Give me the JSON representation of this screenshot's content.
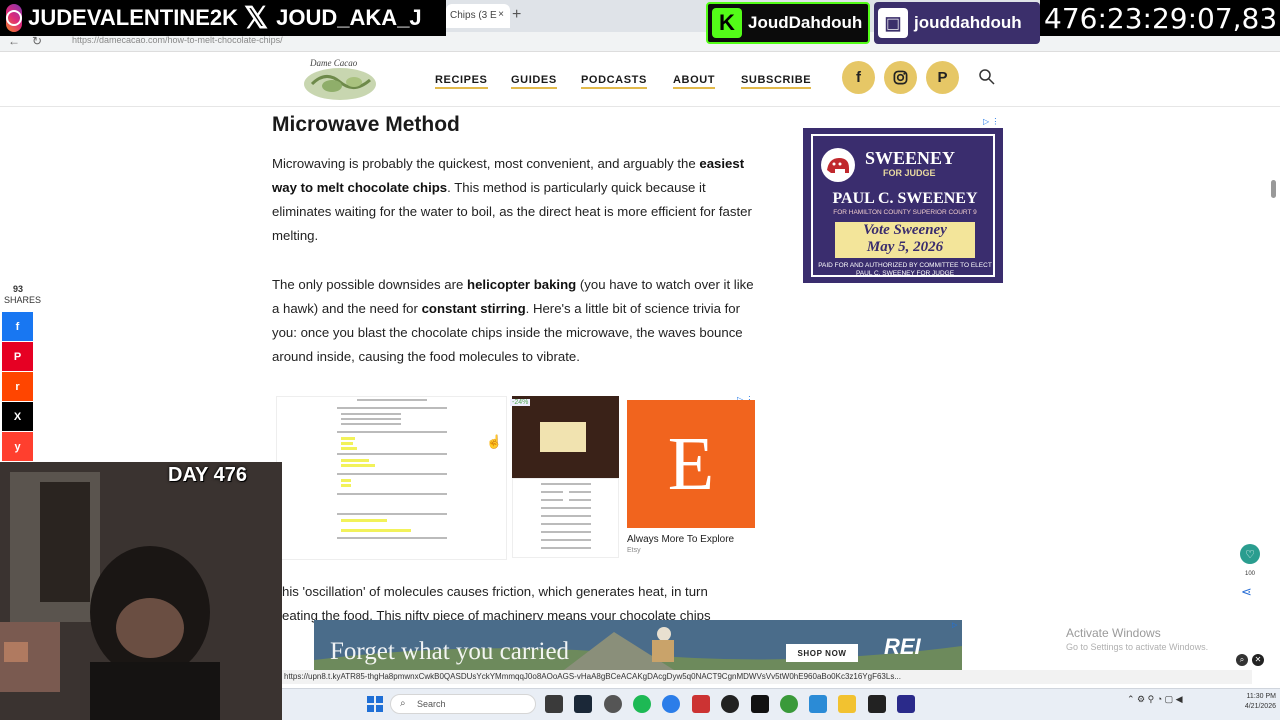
{
  "browser": {
    "tab_title": "Chips (3 E",
    "tab_close": "×",
    "new_tab": "+",
    "url": "https://damecacao.com/how-to-melt-chocolate-chips/",
    "back": "←",
    "reload": "↻"
  },
  "overlay": {
    "instagram": "JUDEVALENTINE2K",
    "x_handle": "JOUD_AKA_J",
    "kick": "JoudDahdouh",
    "twitch": "jouddahdouh",
    "timer": "476:23:29:07,83",
    "day": "DAY 476",
    "colors": {
      "kick": "#53fc18",
      "twitch": "#3b2f6b"
    }
  },
  "site": {
    "nav": [
      "RECIPES",
      "GUIDES",
      "PODCASTS",
      "ABOUT",
      "SUBSCRIBE"
    ],
    "social": [
      "f",
      "ig",
      "P"
    ],
    "accent": "#e6c766"
  },
  "article": {
    "heading": "Microwave Method",
    "p1_a": "Microwaving is probably the quickest, most convenient, and arguably the",
    "p1_bold": "easiest way to melt chocolate chips",
    "p1_b": ". This method is particularly quick because it eliminates waiting for the water to boil, as the direct heat is more efficient for faster melting.",
    "p2_a": "The only possible downsides are",
    "p2_bold1": "helicopter baking",
    "p2_b": "(you have to watch over it like a hawk) and the need for",
    "p2_bold2": "constant stirring",
    "p2_c": ". Here's a little bit of science trivia for you: once you blast the chocolate chips inside the microwave, the waves bounce around inside, causing the food molecules to vibrate.",
    "p3": "his 'oscillation' of molecules causes friction, which generates heat, in turn",
    "p4": "eating the food. This nifty piece of machinery means your chocolate chips"
  },
  "share": {
    "count": "93",
    "label": "SHARES",
    "buttons": [
      {
        "icon": "f",
        "color": "#1877f2"
      },
      {
        "icon": "P",
        "color": "#e60023"
      },
      {
        "icon": "r",
        "color": "#ff4500"
      },
      {
        "icon": "X",
        "color": "#000000"
      },
      {
        "icon": "y",
        "color": "#ff3f2e"
      }
    ]
  },
  "ads": {
    "judge_title": "SWEENEY",
    "judge_for": "FOR JUDGE",
    "judge_name": "PAUL C. SWEENEY",
    "judge_court": "FOR HAMILTON COUNTY SUPERIOR COURT 9",
    "judge_vote": "Vote Sweeney",
    "judge_date": "May 5, 2026",
    "judge_paid": "PAID FOR AND AUTHORIZED BY COMMITTEE TO ELECT PAUL C. SWEENEY FOR JUDGE",
    "discount": "-24%",
    "etsy_caption": "Always More To Explore",
    "etsy_sub": "Etsy",
    "rei_tagline": "Forget what you carried",
    "rei_button": "SHOP NOW",
    "rei_logo": "REI"
  },
  "status_url": "https://upn8.t.kyATR85-thgHa8pmwnxCwkB0QASDUsYckYMmmqqJ0o8AOoAGS-vHaA8gBCeACAKgDAcgDyw5q0NACT9CgnMDWVsVv5tW0hE960aBo0Kc3z16YgF63Ls...",
  "windows": {
    "activate": "Activate Windows",
    "activate_sub": "Go to Settings to activate Windows.",
    "search": "Search",
    "time": "11:30 PM",
    "date": "4/21/2026"
  },
  "floating": {
    "fav_count": "100"
  }
}
